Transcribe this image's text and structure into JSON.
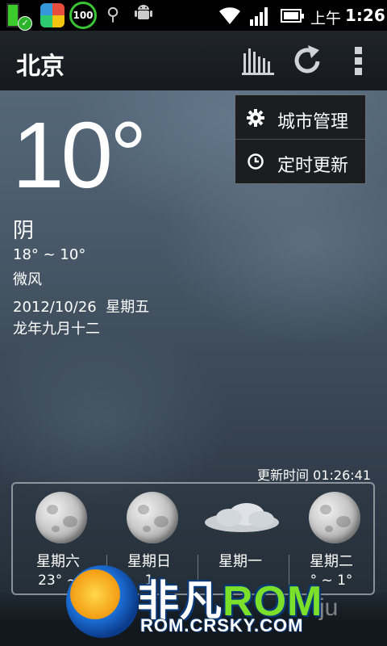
{
  "status_bar": {
    "battery_100": "100",
    "ampm": "上午",
    "time": "1:26"
  },
  "action_bar": {
    "city": "北京",
    "icons": [
      "chart-icon",
      "refresh-icon",
      "overflow-menu-icon"
    ]
  },
  "popup_menu": {
    "items": [
      {
        "label": "城市管理",
        "icon": "gear-icon"
      },
      {
        "label": "定时更新",
        "icon": "clock-icon"
      }
    ]
  },
  "current": {
    "temperature": "10°",
    "condition": "阴",
    "range": "18° ~ 10°",
    "wind": "微风",
    "date": "2012/10/26  星期五",
    "lunar": "龙年九月十二",
    "updated": "更新时间 01:26:41"
  },
  "forecast": [
    {
      "day": "星期六",
      "temp": "23° ~ ",
      "icon": "moon-icon"
    },
    {
      "day": "星期日",
      "temp": "1",
      "icon": "moon-icon"
    },
    {
      "day": "星期一",
      "temp": "",
      "icon": "cloud-icon"
    },
    {
      "day": "星期二",
      "temp": "° ~ 1°",
      "icon": "moon-icon"
    }
  ],
  "watermark": {
    "brand_fan": "非凡",
    "brand_rom": "ROM",
    "url": "ROM.CRSKY.COM",
    "extra": "ju"
  }
}
